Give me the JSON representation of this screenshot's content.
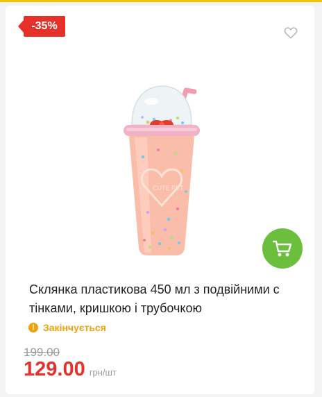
{
  "product": {
    "discount_badge": "-35%",
    "title": "Склянка пластикова 450 мл з подвійними с тінками, кришкою і трубочкою",
    "status": "Закінчується",
    "status_icon": "!",
    "old_price": "199.00",
    "price": "129.00",
    "unit": "грн/шт",
    "image_lettering": "CUTE PET"
  },
  "icons": {
    "favorite": "heart-outline-icon",
    "cart": "cart-icon",
    "status": "warning-icon"
  },
  "colors": {
    "accent_red": "#e5312a",
    "cart_green": "#6cbf3c",
    "warning_orange": "#f1a20a",
    "strip_yellow": "#f4c400"
  }
}
